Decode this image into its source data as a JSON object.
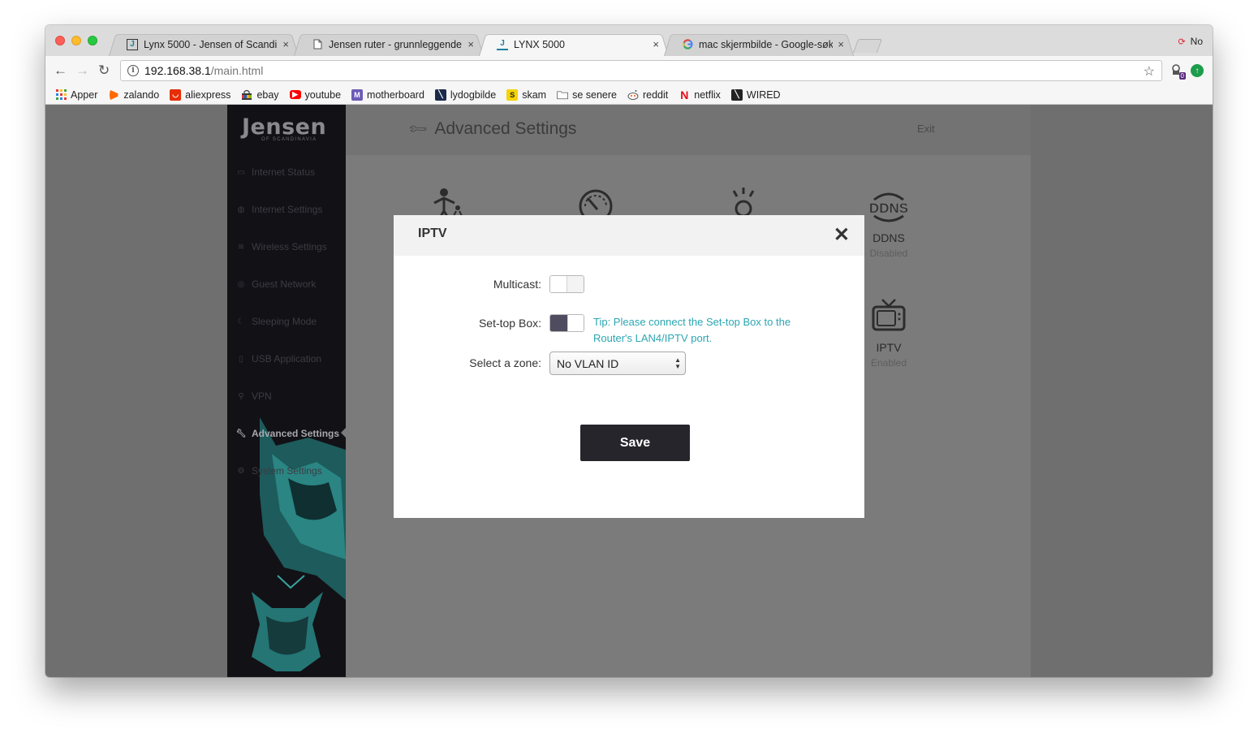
{
  "browser": {
    "tabs": [
      {
        "title": "Lynx 5000 - Jensen of Scandi",
        "favicon": "jensen-j-icon",
        "active": false
      },
      {
        "title": "Jensen ruter - grunnleggende",
        "favicon": "document-icon",
        "active": false
      },
      {
        "title": "LYNX 5000",
        "favicon": "jensen-j-icon",
        "active": true
      },
      {
        "title": "mac skjermbilde - Google-søk",
        "favicon": "google-g-icon",
        "active": false
      }
    ],
    "tab_close": "×",
    "profile_name": "No",
    "address": {
      "host": "192.168.38.1",
      "path": "/main.html"
    },
    "extension_badge": "0",
    "bookmarks": [
      {
        "label": "Apper",
        "icon": "apps-grid-icon",
        "color": "#e53935"
      },
      {
        "label": "zalando",
        "icon": "zalando-icon",
        "color": "#ff6900"
      },
      {
        "label": "aliexpress",
        "icon": "aliexpress-icon",
        "color": "#e62e04"
      },
      {
        "label": "ebay",
        "icon": "ebay-bag-icon",
        "color": "#3a3a3a"
      },
      {
        "label": "youtube",
        "icon": "youtube-icon",
        "color": "#ff0000"
      },
      {
        "label": "motherboard",
        "icon": "motherboard-icon",
        "color": "#6c5bb8"
      },
      {
        "label": "lydogbilde",
        "icon": "lydogbilde-icon",
        "color": "#1a2a4a"
      },
      {
        "label": "skam",
        "icon": "skam-icon",
        "color": "#f5d300"
      },
      {
        "label": "se senere",
        "icon": "folder-icon",
        "color": "#888888"
      },
      {
        "label": "reddit",
        "icon": "reddit-icon",
        "color": "#ff4500"
      },
      {
        "label": "netflix",
        "icon": "netflix-icon",
        "color": "#e50914"
      },
      {
        "label": "WIRED",
        "icon": "wired-icon",
        "color": "#222222"
      }
    ]
  },
  "router": {
    "brand": "Jensen",
    "brand_sub": "OF SCANDINAVIA",
    "nav": [
      {
        "label": "Internet Status",
        "icon": "router-icon"
      },
      {
        "label": "Internet Settings",
        "icon": "globe-icon"
      },
      {
        "label": "Wireless Settings",
        "icon": "wifi-icon"
      },
      {
        "label": "Guest Network",
        "icon": "guest-icon"
      },
      {
        "label": "Sleeping Mode",
        "icon": "moon-icon"
      },
      {
        "label": "USB Application",
        "icon": "usb-icon"
      },
      {
        "label": "VPN",
        "icon": "vpn-icon"
      },
      {
        "label": "Advanced Settings",
        "icon": "wrench-icon",
        "active": true
      },
      {
        "label": "System Settings",
        "icon": "gear-icon"
      }
    ],
    "page_title": "Advanced Settings",
    "exit_label": "Exit",
    "features": [
      {
        "label": "DDNS",
        "status": "Disabled",
        "icon": "ddns-icon"
      },
      {
        "label": "IPTV",
        "status": "Enabled",
        "icon": "tv-icon"
      }
    ]
  },
  "modal": {
    "title": "IPTV",
    "close_glyph": "✕",
    "multicast_label": "Multicast:",
    "multicast_on": false,
    "settop_label": "Set-top Box:",
    "settop_on": true,
    "tip": "Tip: Please connect the Set-top Box to the Router's LAN4/IPTV port.",
    "zone_label": "Select a zone:",
    "zone_value": "No VLAN ID",
    "save_label": "Save"
  },
  "colors": {
    "accent_tip": "#2aa6b1",
    "toggle_on": "#504c60",
    "save_button": "#26252c",
    "sidebar": "#121116"
  }
}
